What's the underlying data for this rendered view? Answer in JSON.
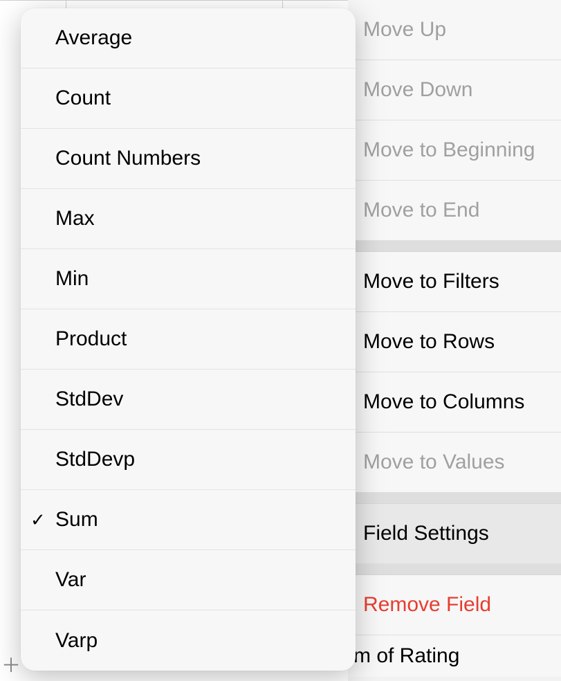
{
  "contextMenu": {
    "items": [
      {
        "label": "Move Up",
        "disabled": true
      },
      {
        "label": "Move Down",
        "disabled": true
      },
      {
        "label": "Move to Beginning",
        "disabled": true
      },
      {
        "label": "Move to End",
        "disabled": true
      }
    ],
    "moveSection": [
      {
        "label": "Move to Filters",
        "disabled": false
      },
      {
        "label": "Move to Rows",
        "disabled": false
      },
      {
        "label": "Move to Columns",
        "disabled": false
      },
      {
        "label": "Move to Values",
        "disabled": true
      }
    ],
    "fieldSettings": "Field Settings",
    "removeField": "Remove Field",
    "footer": "m of Rating"
  },
  "submenu": {
    "items": [
      {
        "label": "Average",
        "selected": false
      },
      {
        "label": "Count",
        "selected": false
      },
      {
        "label": "Count Numbers",
        "selected": false
      },
      {
        "label": "Max",
        "selected": false
      },
      {
        "label": "Min",
        "selected": false
      },
      {
        "label": "Product",
        "selected": false
      },
      {
        "label": "StdDev",
        "selected": false
      },
      {
        "label": "StdDevp",
        "selected": false
      },
      {
        "label": "Sum",
        "selected": true
      },
      {
        "label": "Var",
        "selected": false
      },
      {
        "label": "Varp",
        "selected": false
      }
    ]
  },
  "plusGlyph": "＋"
}
